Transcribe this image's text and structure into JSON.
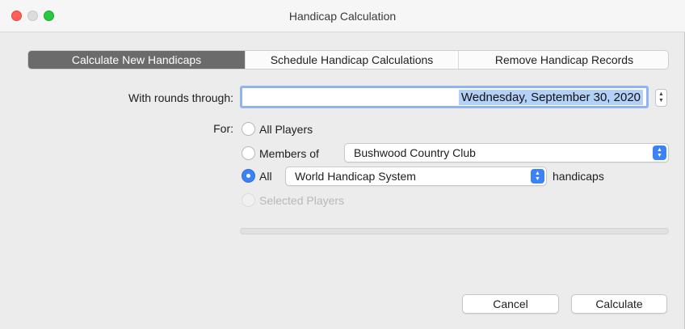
{
  "window": {
    "title": "Handicap Calculation"
  },
  "tabs": [
    {
      "label": "Calculate New Handicaps",
      "active": true
    },
    {
      "label": "Schedule Handicap Calculations",
      "active": false
    },
    {
      "label": "Remove Handicap Records",
      "active": false
    }
  ],
  "form": {
    "rounds_label": "With rounds through:",
    "rounds_value": "Wednesday, September 30, 2020",
    "for_label": "For:",
    "options": {
      "all_players": {
        "label": "All Players",
        "selected": false
      },
      "members_of": {
        "label": "Members of",
        "selected": false,
        "club": "Bushwood Country Club"
      },
      "all": {
        "label": "All",
        "selected": true,
        "system": "World Handicap System",
        "suffix": "handicaps"
      },
      "selected_players": {
        "label": "Selected Players",
        "selected": false,
        "disabled": true
      }
    }
  },
  "progress": {
    "value": 0
  },
  "buttons": {
    "cancel": "Cancel",
    "calculate": "Calculate"
  },
  "colors": {
    "accent": "#3b82f6",
    "active_tab": "#6b6b6b",
    "selection": "#b3d1f7"
  }
}
